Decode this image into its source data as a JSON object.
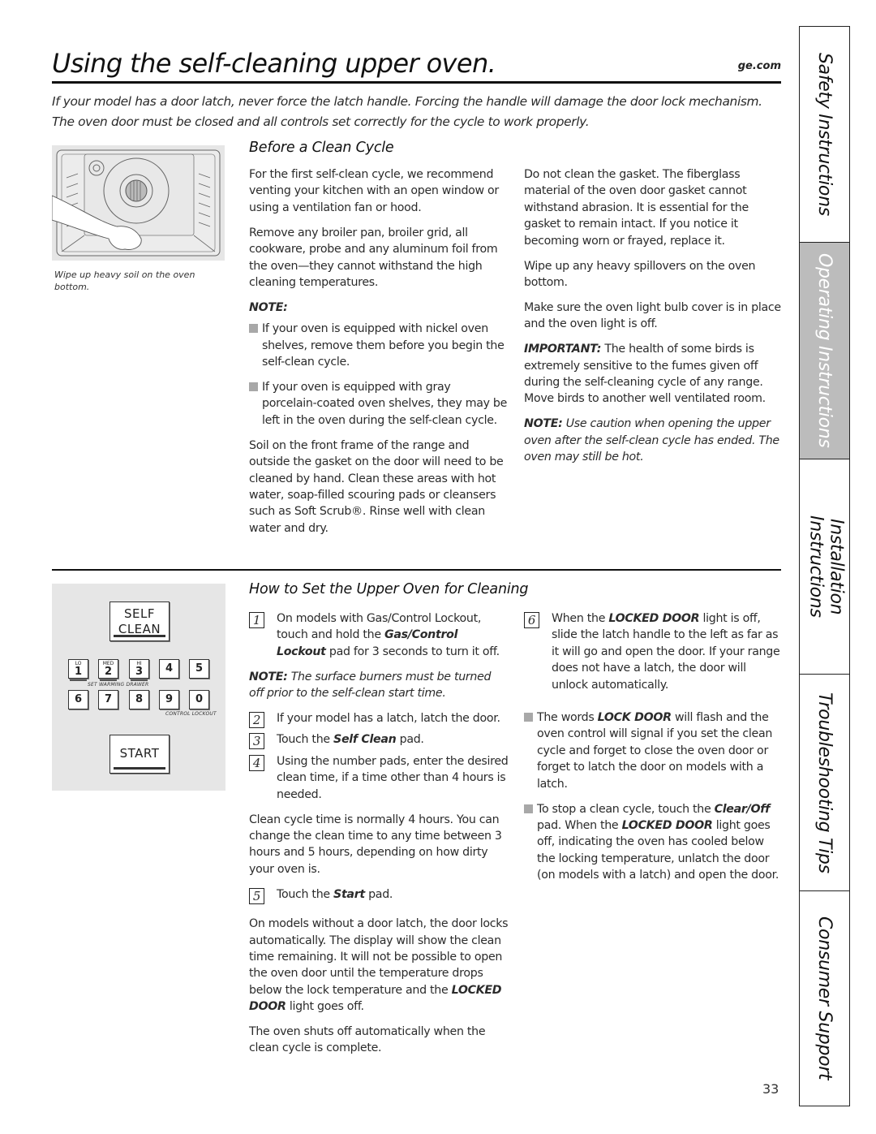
{
  "header": {
    "title": "Using the self-cleaning upper oven.",
    "site": "ge.com",
    "intro": "If your model has a door latch, never force the latch handle. Forcing the handle will damage the door lock mechanism. The oven door must be closed and all controls set correctly for the cycle to work properly."
  },
  "figure_oven": {
    "caption": "Wipe up heavy soil on the oven bottom."
  },
  "before_clean": {
    "heading": "Before a Clean Cycle",
    "p1": "For the first self-clean cycle, we recommend venting your kitchen with an open window or using a ventilation fan or hood.",
    "p2": "Remove any broiler pan, broiler grid, all cookware, probe and any aluminum foil from the oven—they cannot withstand the high cleaning temperatures.",
    "note_label": "NOTE:",
    "bullets": [
      "If your oven is equipped with nickel oven shelves, remove them before you begin the self-clean cycle.",
      "If your oven is equipped with gray porcelain-coated oven shelves, they may be left in the oven during the self-clean cycle."
    ],
    "p3": "Soil on the front frame of the range and outside the gasket on the door will need to be cleaned by hand. Clean these areas with hot water, soap-filled scouring pads or cleansers such as Soft Scrub®. Rinse well with clean water and dry.",
    "p4": "Do not clean the gasket. The fiberglass material of the oven door gasket cannot withstand abrasion. It is essential for the gasket to remain intact. If you notice it becoming worn or frayed, replace it.",
    "p5": "Wipe up any heavy spillovers on the oven bottom.",
    "p6": "Make sure the oven light bulb cover is in place and the oven light is off.",
    "important_label": "IMPORTANT:",
    "important_text": " The health of some birds is extremely sensitive to the fumes given off during the self-cleaning cycle of any range. Move birds to another well ventilated room.",
    "note2_label": "NOTE:",
    "note2_text": " Use caution when opening the upper oven after the self-clean cycle has ended. The oven may still be hot."
  },
  "control_panel": {
    "self_clean_line1": "SELF",
    "self_clean_line2": "CLEAN",
    "keys": [
      {
        "digit": "1",
        "sup": "LO"
      },
      {
        "digit": "2",
        "sup": "MED"
      },
      {
        "digit": "3",
        "sup": "HI"
      },
      {
        "digit": "4",
        "sup": ""
      },
      {
        "digit": "5",
        "sup": ""
      },
      {
        "digit": "6",
        "sup": ""
      },
      {
        "digit": "7",
        "sup": ""
      },
      {
        "digit": "8",
        "sup": ""
      },
      {
        "digit": "9",
        "sup": ""
      },
      {
        "digit": "0",
        "sup": ""
      }
    ],
    "warming_label": "SET WARMING DRAWER",
    "lockout_label": "CONTROL LOCKOUT",
    "start": "START"
  },
  "how_to": {
    "heading": "How to Set the Upper Oven for Cleaning",
    "step1_num": "1",
    "step1_a": "On models with Gas/Control Lockout, touch and hold the ",
    "step1_b": "Gas/Control Lockout",
    "step1_c": " pad for 3 seconds to turn it off.",
    "note_label": "NOTE:",
    "note_text": " The surface burners must be turned off prior to the self-clean start time.",
    "step2_num": "2",
    "step2": "If your model has a latch, latch the door.",
    "step3_num": "3",
    "step3_a": "Touch the ",
    "step3_b": "Self Clean",
    "step3_c": " pad.",
    "step4_num": "4",
    "step4": "Using the number pads, enter the desired clean time, if a time other than 4 hours is needed.",
    "cycle_time": "Clean cycle time is normally 4 hours. You can change the clean time to any time between 3 hours and 5 hours, depending on how dirty your oven is.",
    "step5_num": "5",
    "step5_a": "Touch the ",
    "step5_b": "Start",
    "step5_c": " pad.",
    "no_latch_a": "On models without a door latch, the door locks automatically. The display will show the clean time remaining. It will not be possible to open the oven door until the temperature drops below the lock temperature and the ",
    "no_latch_b": "LOCKED DOOR",
    "no_latch_c": " light goes off.",
    "shutoff": "The oven shuts off automatically when the clean cycle is complete.",
    "step6_num": "6",
    "step6_a": "When the ",
    "step6_b": "LOCKED DOOR",
    "step6_c": " light is off, slide the latch handle to the left as far as it will go and open the door. If your range does not have a latch, the door will unlock automatically.",
    "bullet1_a": "The words ",
    "bullet1_b": "LOCK DOOR",
    "bullet1_c": " will flash and the oven control will signal if you set the clean cycle and forget to close the oven door or forget to latch the door on models with a latch.",
    "bullet2_a": "To stop a clean cycle, touch the ",
    "bullet2_b": "Clear/Off",
    "bullet2_c": " pad. When the ",
    "bullet2_d": "LOCKED DOOR",
    "bullet2_e": " light goes off, indicating the oven has cooled below the locking temperature, unlatch the door (on models with a latch) and open the door."
  },
  "side_tabs": [
    {
      "label": "Safety Instructions",
      "active": false
    },
    {
      "label": "Operating Instructions",
      "active": true
    },
    {
      "label": "Installation Instructions",
      "active": false
    },
    {
      "label": "Troubleshooting Tips",
      "active": false
    },
    {
      "label": "Consumer Support",
      "active": false
    }
  ],
  "page_number": "33"
}
